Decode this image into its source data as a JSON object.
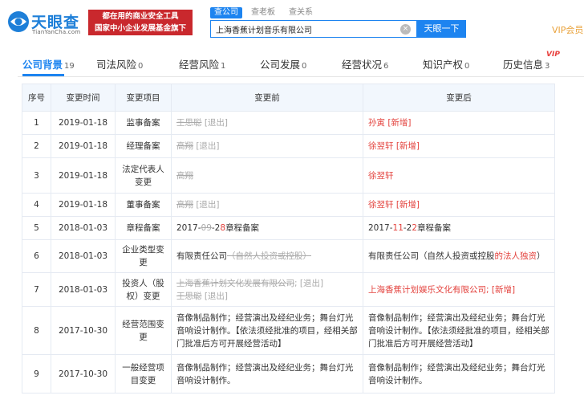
{
  "logo": {
    "title": "天眼查",
    "subtitle": "TianYanCha.com"
  },
  "banner": {
    "line1": "都在用的商业安全工具",
    "line2": "国家中小企业发展基金旗下"
  },
  "search": {
    "tabs": [
      "查公司",
      "查老板",
      "查关系"
    ],
    "query": "上海香蕉计划音乐有限公司",
    "button": "天眼一下"
  },
  "vip_link": "VIP会员",
  "nav": {
    "items": [
      {
        "label": "公司背景",
        "count": "19"
      },
      {
        "label": "司法风险",
        "count": "0"
      },
      {
        "label": "经营风险",
        "count": "1"
      },
      {
        "label": "公司发展",
        "count": "0"
      },
      {
        "label": "经营状况",
        "count": "6"
      },
      {
        "label": "知识产权",
        "count": "0"
      },
      {
        "label": "历史信息",
        "count": "3"
      }
    ],
    "vip_tag": "VIP"
  },
  "table": {
    "headers": [
      "序号",
      "变更时间",
      "变更项目",
      "变更前",
      "变更后"
    ],
    "rows": [
      {
        "no": "1",
        "date": "2019-01-18",
        "item": "监事备案",
        "before": [
          {
            "t": "王思聪",
            "s": "del"
          },
          {
            "t": " [退出]",
            "s": "exit"
          }
        ],
        "after": [
          {
            "t": "孙寅",
            "s": "add"
          },
          {
            "t": " [新增]",
            "s": "add"
          }
        ]
      },
      {
        "no": "2",
        "date": "2019-01-18",
        "item": "经理备案",
        "before": [
          {
            "t": "高翔",
            "s": "del"
          },
          {
            "t": " [退出]",
            "s": "exit"
          }
        ],
        "after": [
          {
            "t": "徐翌轩",
            "s": "add"
          },
          {
            "t": " [新增]",
            "s": "add"
          }
        ]
      },
      {
        "no": "3",
        "date": "2019-01-18",
        "item": "法定代表人变更",
        "before": [
          {
            "t": "高翔",
            "s": "del"
          }
        ],
        "after": [
          {
            "t": "徐翌轩",
            "s": "add"
          }
        ]
      },
      {
        "no": "4",
        "date": "2019-01-18",
        "item": "董事备案",
        "before": [
          {
            "t": "高翔",
            "s": "del"
          },
          {
            "t": " [退出]",
            "s": "exit"
          }
        ],
        "after": [
          {
            "t": "徐翌轩",
            "s": "add"
          },
          {
            "t": " [新增]",
            "s": "add"
          }
        ]
      },
      {
        "no": "5",
        "date": "2018-01-03",
        "item": "章程备案",
        "before": [
          {
            "t": "2017-",
            "s": "plain"
          },
          {
            "t": "09",
            "s": "del"
          },
          {
            "t": "-2",
            "s": "plain"
          },
          {
            "t": "8",
            "s": "red"
          },
          {
            "t": "章程备案",
            "s": "plain"
          }
        ],
        "after": [
          {
            "t": "2017-",
            "s": "plain"
          },
          {
            "t": "11",
            "s": "red"
          },
          {
            "t": "-2",
            "s": "plain"
          },
          {
            "t": "2",
            "s": "red"
          },
          {
            "t": "章程备案",
            "s": "plain"
          }
        ]
      },
      {
        "no": "6",
        "date": "2018-01-03",
        "item": "企业类型变更",
        "before": [
          {
            "t": "有限责任公司",
            "s": "plain"
          },
          {
            "t": "（自然人投资或控股）",
            "s": "del"
          }
        ],
        "after": [
          {
            "t": "有限责任公司（自然人投资或控股",
            "s": "plain"
          },
          {
            "t": "的法人独资",
            "s": "add"
          },
          {
            "t": "）",
            "s": "plain"
          }
        ]
      },
      {
        "no": "7",
        "date": "2018-01-03",
        "item": "投资人（股权）变更",
        "before": [
          {
            "t": "上海香蕉计划文化发展有限公司",
            "s": "del"
          },
          {
            "t": "; [退出]",
            "s": "exit"
          },
          {
            "t": "",
            "s": "br"
          },
          {
            "t": "王思聪",
            "s": "del"
          },
          {
            "t": " [退出]",
            "s": "exit"
          }
        ],
        "after": [
          {
            "t": "上海香蕉计划娱乐文化有限公司; [新增]",
            "s": "add"
          }
        ]
      },
      {
        "no": "8",
        "date": "2017-10-30",
        "item": "经营范围变更",
        "before": [
          {
            "t": "音像制品制作；经营演出及经纪业务；舞台灯光音响设计制作。【依法须经批准的项目，经相关部门批准后方可开展经营活动】",
            "s": "plain"
          }
        ],
        "after": [
          {
            "t": "音像制品制作；经营演出及经纪业务；舞台灯光音响设计制作。【依法须经批准的项目，经相关部门批准后方可开展经营活动】",
            "s": "plain"
          }
        ]
      },
      {
        "no": "9",
        "date": "2017-10-30",
        "item": "一般经营项目变更",
        "before": [
          {
            "t": "音像制品制作；经营演出及经纪业务；舞台灯光音响设计制作。",
            "s": "plain"
          }
        ],
        "after": [
          {
            "t": "音像制品制作；经营演出及经纪业务；舞台灯光音响设计制作。",
            "s": "plain"
          }
        ]
      }
    ]
  }
}
